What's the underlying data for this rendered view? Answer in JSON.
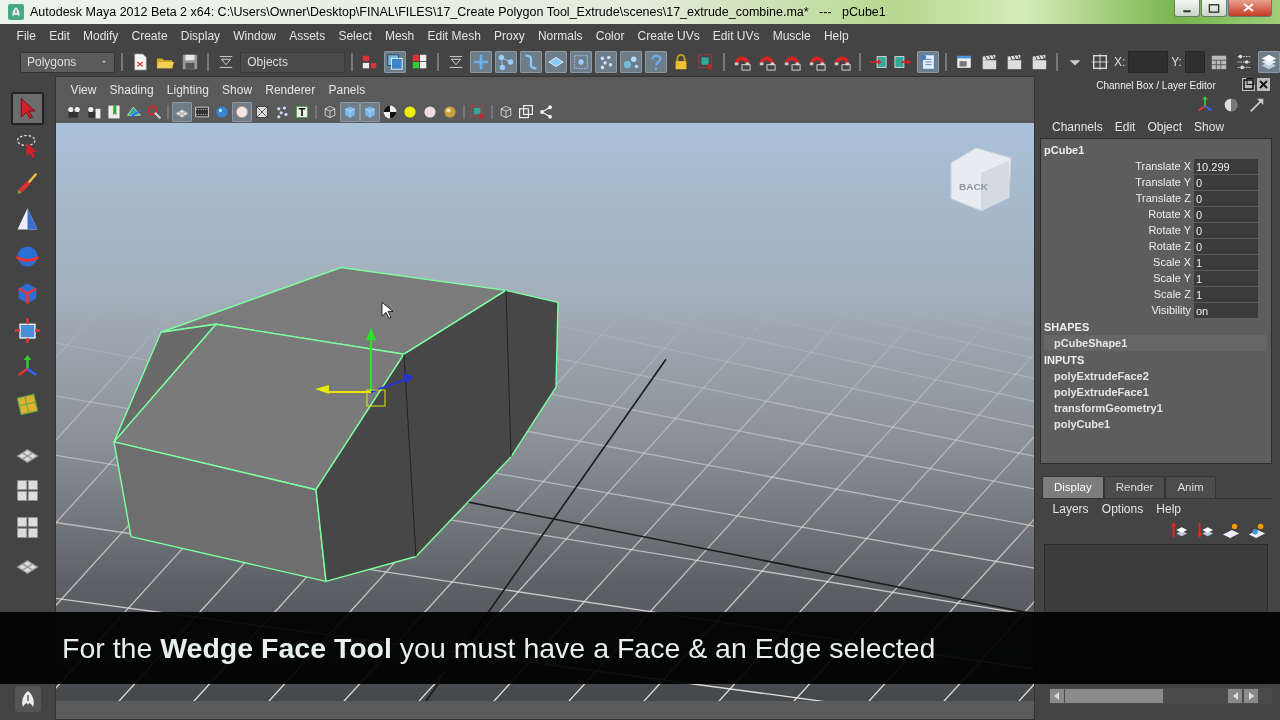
{
  "window": {
    "title": "Autodesk Maya 2012 Beta 2 x64: C:\\Users\\Owner\\Desktop\\FINAL\\FILES\\17_Create Polygon Tool_Extrude\\scenes\\17_extrude_combine.ma*   ---   pCube1"
  },
  "menu_bar": [
    "File",
    "Edit",
    "Modify",
    "Create",
    "Display",
    "Window",
    "Assets",
    "Select",
    "Mesh",
    "Edit Mesh",
    "Proxy",
    "Normals",
    "Color",
    "Create UVs",
    "Edit UVs",
    "Muscle",
    "Help"
  ],
  "status_line": {
    "menu_set": "Polygons",
    "selection_mode": "Objects",
    "x_label": "X:",
    "y_label": "Y:",
    "buttons": [
      {
        "pressed": false
      },
      {
        "pressed": false
      },
      {
        "pressed": false
      },
      {
        "pressed": false
      },
      {
        "pressed": true
      },
      {
        "pressed": false
      },
      {
        "pressed": false
      },
      {
        "pressed": true
      },
      {
        "pressed": true
      },
      {
        "pressed": true
      },
      {
        "pressed": true
      },
      {
        "pressed": true
      },
      {
        "pressed": true
      },
      {
        "pressed": true
      },
      {
        "pressed": true
      },
      {
        "pressed": false
      },
      {
        "pressed": false
      },
      {
        "pressed": false
      },
      {
        "pressed": false
      },
      {
        "pressed": false
      },
      {
        "pressed": false
      },
      {
        "pressed": false
      },
      {
        "pressed": false
      },
      {
        "pressed": false
      },
      {
        "pressed": true
      },
      {
        "pressed": false
      },
      {
        "pressed": false
      },
      {
        "pressed": false
      },
      {
        "pressed": false
      },
      {
        "pressed": false
      },
      {
        "pressed": false
      },
      {
        "pressed": false
      },
      {
        "pressed": false
      },
      {
        "pressed": true
      }
    ]
  },
  "tool_box": {
    "tools": [
      {
        "selected": true
      },
      {
        "selected": false
      },
      {
        "selected": false
      },
      {
        "selected": false
      },
      {
        "selected": false
      },
      {
        "selected": false
      },
      {
        "selected": false
      },
      {
        "selected": false
      },
      {
        "selected": false
      },
      {
        "selected": false
      },
      {
        "selected": false
      },
      {
        "selected": false
      },
      {
        "selected": false
      }
    ]
  },
  "viewport": {
    "menu": [
      "View",
      "Shading",
      "Lighting",
      "Show",
      "Renderer",
      "Panels"
    ],
    "buttons": [
      {
        "pressed": false
      },
      {
        "pressed": false
      },
      {
        "pressed": false
      },
      {
        "pressed": false
      },
      {
        "pressed": false
      },
      {
        "pressed": true
      },
      {
        "pressed": false
      },
      {
        "pressed": false
      },
      {
        "pressed": true
      },
      {
        "pressed": false
      },
      {
        "pressed": false
      },
      {
        "pressed": false
      },
      {
        "pressed": false
      },
      {
        "pressed": true
      },
      {
        "pressed": true
      },
      {
        "pressed": false
      },
      {
        "pressed": false
      },
      {
        "pressed": false
      },
      {
        "pressed": false
      },
      {
        "pressed": false
      },
      {
        "pressed": false
      },
      {
        "pressed": false
      },
      {
        "pressed": false
      }
    ],
    "view_cube": "BACK",
    "caption": "For the **Wedge Face Tool** you must have a Face & an Edge selected"
  },
  "channel_box": {
    "title": "Channel Box / Layer Editor",
    "menu": [
      "Channels",
      "Edit",
      "Object",
      "Show"
    ],
    "object": "pCube1",
    "channels": [
      {
        "name": "Translate X",
        "value": "10.299"
      },
      {
        "name": "Translate Y",
        "value": "0"
      },
      {
        "name": "Translate Z",
        "value": "0"
      },
      {
        "name": "Rotate X",
        "value": "0"
      },
      {
        "name": "Rotate Y",
        "value": "0"
      },
      {
        "name": "Rotate Z",
        "value": "0"
      },
      {
        "name": "Scale X",
        "value": "1"
      },
      {
        "name": "Scale Y",
        "value": "1"
      },
      {
        "name": "Scale Z",
        "value": "1"
      },
      {
        "name": "Visibility",
        "value": "on"
      }
    ],
    "shapes_heading": "SHAPES",
    "shapes": [
      "pCubeShape1"
    ],
    "inputs_heading": "INPUTS",
    "inputs": [
      "polyExtrudeFace2",
      "polyExtrudeFace1",
      "transformGeometry1",
      "polyCube1"
    ]
  },
  "layer_editor": {
    "tabs": [
      {
        "label": "Display",
        "selected": true
      },
      {
        "label": "Render",
        "selected": false
      },
      {
        "label": "Anim",
        "selected": false
      }
    ],
    "menu": [
      "Layers",
      "Options",
      "Help"
    ]
  }
}
